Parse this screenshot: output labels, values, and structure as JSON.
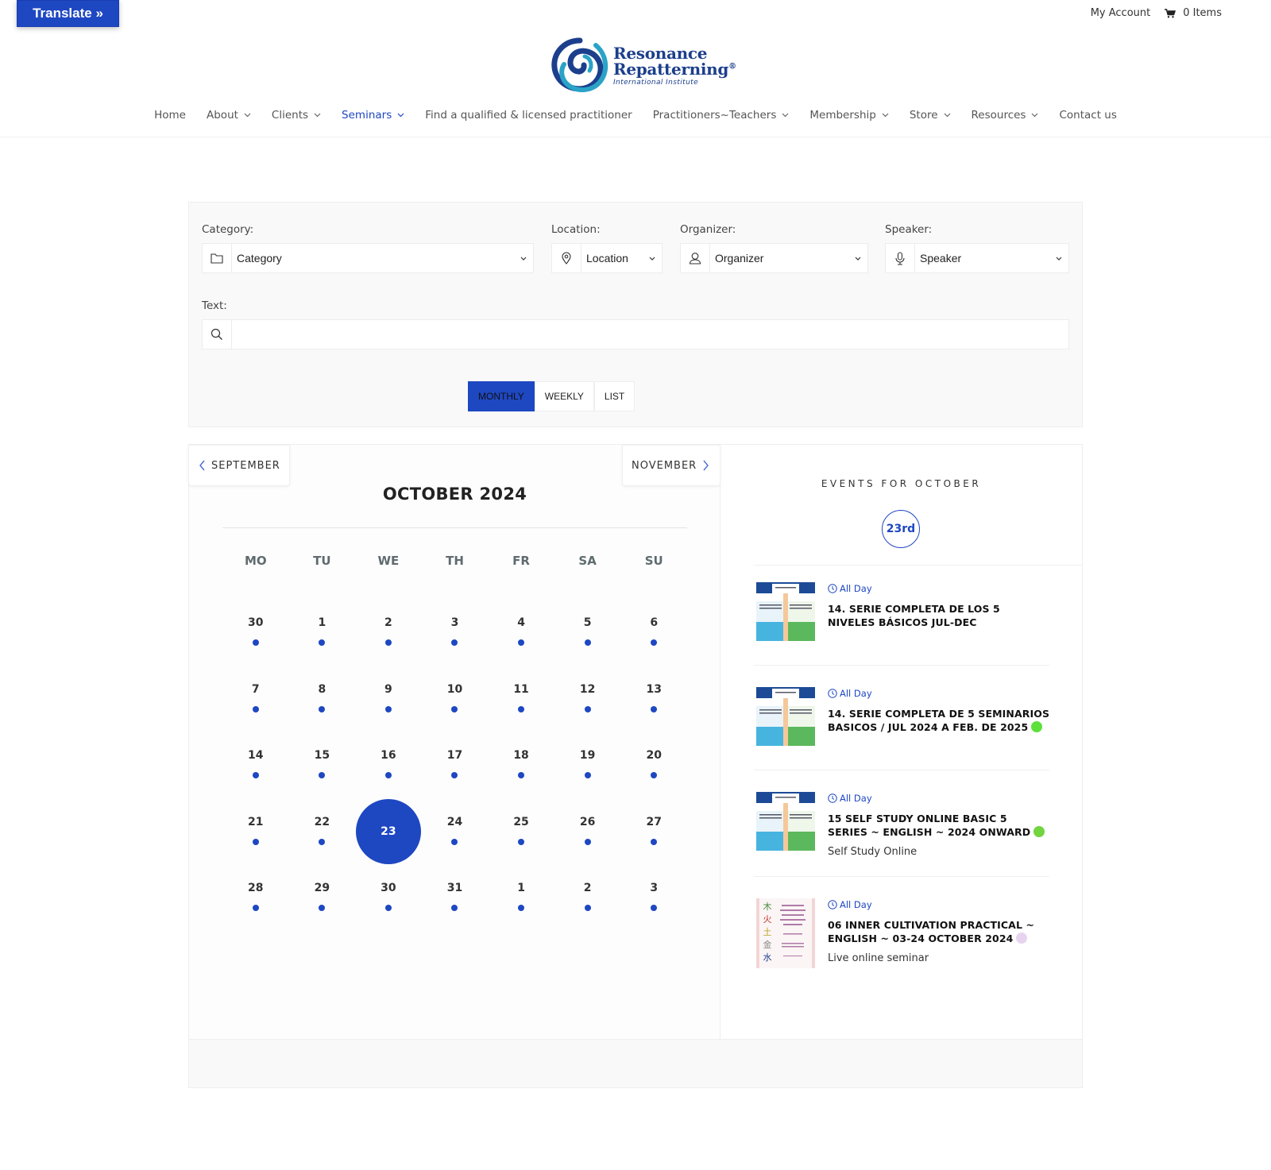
{
  "translate": {
    "label": "Translate »"
  },
  "header": {
    "my_account": "My Account",
    "cart_label": "0 Items",
    "cart_icon": "shopping-cart-icon"
  },
  "logo": {
    "line1": "Resonance",
    "line2": "Repatterning",
    "registered": "®",
    "line3": "International Institute",
    "colors": {
      "navy": "#1c3f8c",
      "teal": "#2aa3c6"
    }
  },
  "nav": {
    "items": [
      {
        "label": "Home",
        "dropdown": false,
        "active": false
      },
      {
        "label": "About",
        "dropdown": true,
        "active": false
      },
      {
        "label": "Clients",
        "dropdown": true,
        "active": false
      },
      {
        "label": "Seminars",
        "dropdown": true,
        "active": true
      },
      {
        "label": "Find a qualified & licensed practitioner",
        "dropdown": false,
        "active": false
      },
      {
        "label": "Practitioners~Teachers",
        "dropdown": true,
        "active": false
      },
      {
        "label": "Membership",
        "dropdown": true,
        "active": false
      },
      {
        "label": "Store",
        "dropdown": true,
        "active": false
      },
      {
        "label": "Resources",
        "dropdown": true,
        "active": false
      },
      {
        "label": "Contact us",
        "dropdown": false,
        "active": false
      }
    ]
  },
  "filters": {
    "category": {
      "label": "Category:",
      "value": "Category",
      "icon": "folder-icon"
    },
    "location": {
      "label": "Location:",
      "value": "Location",
      "icon": "map-pin-icon"
    },
    "organizer": {
      "label": "Organizer:",
      "value": "Organizer",
      "icon": "user-icon"
    },
    "speaker": {
      "label": "Speaker:",
      "value": "Speaker",
      "icon": "microphone-icon"
    },
    "text": {
      "label": "Text:",
      "value": "",
      "placeholder": "",
      "icon": "search-icon"
    }
  },
  "view_tabs": [
    {
      "label": "MONTHLY",
      "active": true
    },
    {
      "label": "WEEKLY",
      "active": false
    },
    {
      "label": "LIST",
      "active": false
    }
  ],
  "calendar": {
    "prev_label": "SEPTEMBER",
    "next_label": "NOVEMBER",
    "title": "OCTOBER 2024",
    "weekdays": [
      "MO",
      "TU",
      "WE",
      "TH",
      "FR",
      "SA",
      "SU"
    ],
    "selected_day": "23",
    "accent": "#1e47c2",
    "days": [
      {
        "n": "30",
        "has_event": true
      },
      {
        "n": "1",
        "has_event": true
      },
      {
        "n": "2",
        "has_event": true
      },
      {
        "n": "3",
        "has_event": true
      },
      {
        "n": "4",
        "has_event": true
      },
      {
        "n": "5",
        "has_event": true
      },
      {
        "n": "6",
        "has_event": true
      },
      {
        "n": "7",
        "has_event": true
      },
      {
        "n": "8",
        "has_event": true
      },
      {
        "n": "9",
        "has_event": true
      },
      {
        "n": "10",
        "has_event": true
      },
      {
        "n": "11",
        "has_event": true
      },
      {
        "n": "12",
        "has_event": true
      },
      {
        "n": "13",
        "has_event": true
      },
      {
        "n": "14",
        "has_event": true
      },
      {
        "n": "15",
        "has_event": true
      },
      {
        "n": "16",
        "has_event": true
      },
      {
        "n": "17",
        "has_event": true
      },
      {
        "n": "18",
        "has_event": true
      },
      {
        "n": "19",
        "has_event": true
      },
      {
        "n": "20",
        "has_event": true
      },
      {
        "n": "21",
        "has_event": true
      },
      {
        "n": "22",
        "has_event": true
      },
      {
        "n": "23",
        "has_event": true,
        "selected": true
      },
      {
        "n": "24",
        "has_event": true
      },
      {
        "n": "25",
        "has_event": true
      },
      {
        "n": "26",
        "has_event": true
      },
      {
        "n": "27",
        "has_event": true
      },
      {
        "n": "28",
        "has_event": true
      },
      {
        "n": "29",
        "has_event": true
      },
      {
        "n": "30",
        "has_event": true
      },
      {
        "n": "31",
        "has_event": true
      },
      {
        "n": "1",
        "has_event": true
      },
      {
        "n": "2",
        "has_event": true
      },
      {
        "n": "3",
        "has_event": true
      }
    ]
  },
  "events_panel": {
    "heading": "EVENTS FOR OCTOBER",
    "date_badge": "23rd",
    "events": [
      {
        "time": "All Day",
        "title": "14. SERIE COMPLETA DE LOS 5 NIVELES BÁSICOS JUL-DEC",
        "location": "",
        "dot_color": "",
        "thumb": "book-covers-image"
      },
      {
        "time": "All Day",
        "title": "14. SERIE COMPLETA DE 5 SEMINARIOS BASICOS / JUL 2024 A FEB. DE 2025",
        "location": "",
        "dot_color": "#5ee03a",
        "thumb": "book-covers-image"
      },
      {
        "time": "All Day",
        "title": "15 SELF STUDY ONLINE BASIC 5 SERIES ~ ENGLISH ~ 2024 ONWARD",
        "location": "Self Study Online",
        "dot_color": "#72d43f",
        "thumb": "book-covers-image"
      },
      {
        "time": "All Day",
        "title": "06 INNER CULTIVATION PRACTICAL ~ ENGLISH ~ 03-24 OCTOBER 2024",
        "location": "Live online seminar",
        "dot_color": "#e8d3ee",
        "thumb": "inner-cultivation-cover-image"
      }
    ]
  }
}
